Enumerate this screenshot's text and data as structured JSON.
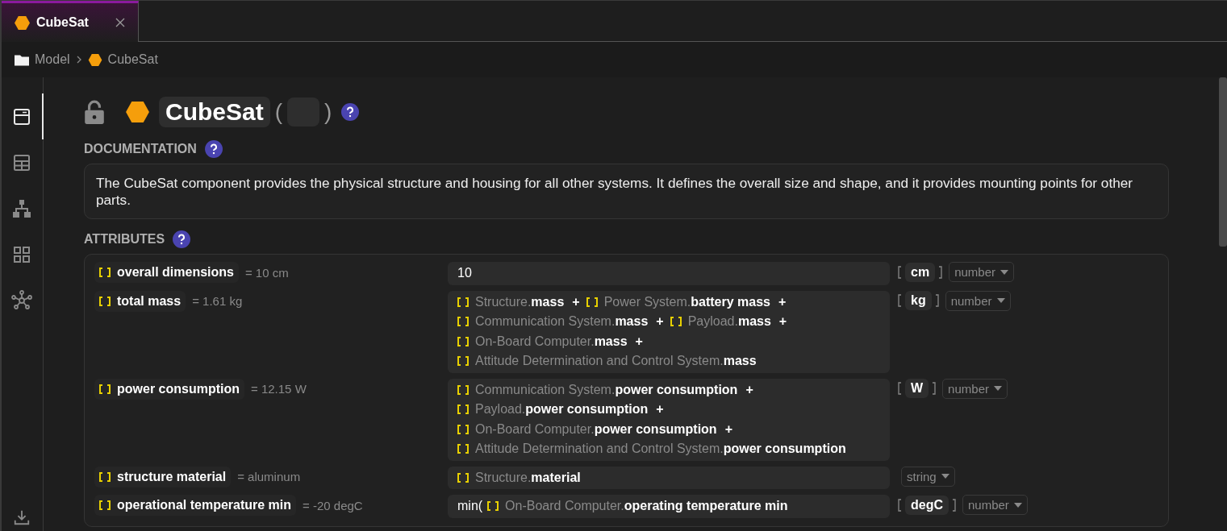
{
  "tabs": [
    {
      "label": "CubeSat",
      "selected": true
    }
  ],
  "breadcrumb": [
    {
      "label": "Model",
      "kind": "folder"
    },
    {
      "label": "CubeSat",
      "kind": "component"
    }
  ],
  "sidebar": {
    "items": [
      {
        "kind": "form",
        "selected": true
      },
      {
        "kind": "table",
        "selected": false
      },
      {
        "kind": "tree",
        "selected": false
      },
      {
        "kind": "grid",
        "selected": false
      },
      {
        "kind": "network",
        "selected": false
      }
    ],
    "bottom": [
      {
        "kind": "download"
      }
    ]
  },
  "element": {
    "locked": false,
    "name": "CubeSat",
    "open_paren": "(",
    "close_paren": ")"
  },
  "documentation": {
    "heading": "DOCUMENTATION",
    "text": "The CubeSat component provides the physical structure and housing for all other systems. It defines the overall size and shape, and it provides mounting points for other parts."
  },
  "attributes": {
    "heading": "ATTRIBUTES",
    "rows": [
      {
        "name": "overall dimensions",
        "value": "= 10 cm",
        "formula": [
          [
            {
              "kind": "text",
              "text": "10"
            }
          ]
        ],
        "unit": "cm",
        "type": "number"
      },
      {
        "name": "total mass",
        "value": "= 1.61 kg",
        "formula": [
          [
            {
              "kind": "ref",
              "object": "Structure.",
              "attribute": "mass"
            },
            {
              "kind": "op",
              "text": "+"
            },
            {
              "kind": "ref",
              "object": "Power System.",
              "attribute": "battery mass"
            },
            {
              "kind": "op",
              "text": "+"
            }
          ],
          [
            {
              "kind": "ref",
              "object": "Communication System.",
              "attribute": "mass"
            },
            {
              "kind": "op",
              "text": "+"
            },
            {
              "kind": "ref",
              "object": "Payload.",
              "attribute": "mass"
            },
            {
              "kind": "op",
              "text": "+"
            }
          ],
          [
            {
              "kind": "ref",
              "object": "On-Board Computer.",
              "attribute": "mass"
            },
            {
              "kind": "op",
              "text": "+"
            }
          ],
          [
            {
              "kind": "ref",
              "object": "Attitude Determination and Control System.",
              "attribute": "mass"
            }
          ]
        ],
        "unit": "kg",
        "type": "number"
      },
      {
        "name": "power consumption",
        "value": "= 12.15 W",
        "formula": [
          [
            {
              "kind": "ref",
              "object": "Communication System.",
              "attribute": "power consumption"
            },
            {
              "kind": "op",
              "text": "+"
            }
          ],
          [
            {
              "kind": "ref",
              "object": "Payload.",
              "attribute": "power consumption"
            },
            {
              "kind": "op",
              "text": "+"
            }
          ],
          [
            {
              "kind": "ref",
              "object": "On-Board Computer.",
              "attribute": "power consumption"
            },
            {
              "kind": "op",
              "text": "+"
            }
          ],
          [
            {
              "kind": "ref",
              "object": "Attitude Determination and Control System.",
              "attribute": "power consumption"
            }
          ]
        ],
        "unit": "W",
        "type": "number"
      },
      {
        "name": "structure material",
        "value": "= aluminum",
        "formula": [
          [
            {
              "kind": "ref",
              "object": "Structure.",
              "attribute": "material"
            }
          ]
        ],
        "type": "string"
      },
      {
        "name": "operational temperature min",
        "value": "= -20 degC",
        "formula": [
          [
            {
              "kind": "text",
              "text": "min("
            },
            {
              "kind": "ref",
              "object": "On-Board Computer.",
              "attribute": "operating temperature min"
            }
          ]
        ],
        "unit": "degC",
        "type": "number"
      }
    ]
  }
}
